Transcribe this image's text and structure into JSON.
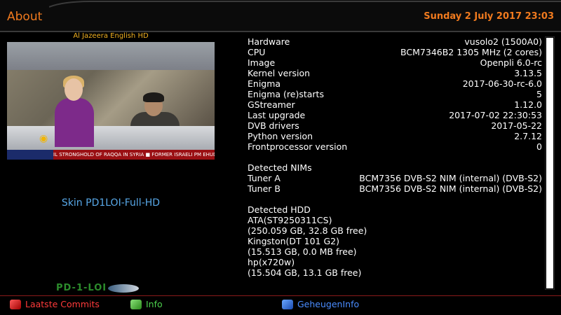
{
  "header": {
    "title": "About",
    "datetime": "Sunday  2 July 2017  23:03"
  },
  "channel": {
    "name": "Al Jazeera English HD",
    "ticker": "IL STRONGHOLD OF RAQQA IN SYRIA  ■ FORMER ISRAELI PM EHUD B"
  },
  "skin_label": "Skin PD1LOI-Full-HD",
  "logo_text": "PD-1-LOI",
  "info": {
    "system": [
      {
        "key": "Hardware",
        "value": "vusolo2 (1500A0)"
      },
      {
        "key": "CPU",
        "value": "BCM7346B2 1305 MHz (2 cores)"
      },
      {
        "key": "Image",
        "value": "Openpli 6.0-rc"
      },
      {
        "key": "Kernel version",
        "value": "3.13.5"
      },
      {
        "key": "Enigma",
        "value": "2017-06-30-rc-6.0"
      },
      {
        "key": "Enigma (re)starts",
        "value": "5"
      },
      {
        "key": "GStreamer",
        "value": "1.12.0"
      },
      {
        "key": "Last upgrade",
        "value": "2017-07-02 22:30:53"
      },
      {
        "key": "DVB drivers",
        "value": "2017-05-22"
      },
      {
        "key": "Python version",
        "value": "2.7.12"
      },
      {
        "key": "Frontprocessor version",
        "value": "0"
      }
    ],
    "nims_title": "Detected NIMs",
    "nims": [
      {
        "key": "Tuner A",
        "value": "BCM7356 DVB-S2 NIM (internal) (DVB-S2)"
      },
      {
        "key": "Tuner B",
        "value": "BCM7356 DVB-S2 NIM (internal) (DVB-S2)"
      }
    ],
    "hdd_title": "Detected HDD",
    "hdd": [
      "ATA(ST9250311CS)",
      "(250.059 GB, 32.8 GB free)",
      "Kingston(DT 101 G2)",
      "(15.513 GB, 0.0 MB free)",
      "hp(x720w)",
      "(15.504 GB, 13.1 GB free)"
    ]
  },
  "footer": {
    "red": "Laatste Commits",
    "green": "Info",
    "blue": "GeheugenInfo"
  },
  "colors": {
    "accent": "#f07a1e",
    "skin_text": "#58a8e8",
    "red": "#ff3a3a",
    "green": "#4cd04c",
    "blue": "#4a8cff"
  }
}
